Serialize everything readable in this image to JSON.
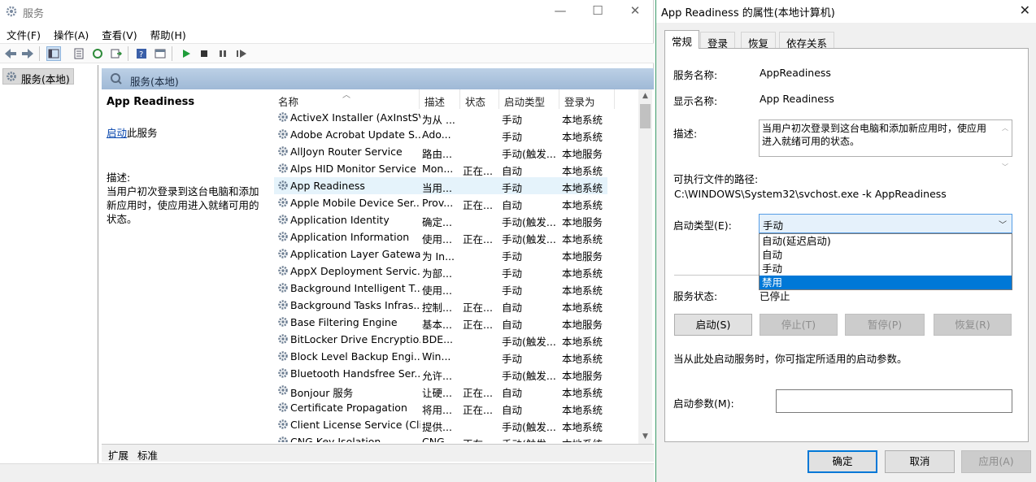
{
  "services_window": {
    "title": "服务",
    "controls": {
      "minimize": "—",
      "maximize": "☐",
      "close": "✕"
    },
    "menu": [
      "文件(F)",
      "操作(A)",
      "查看(V)",
      "帮助(H)"
    ],
    "tree_root": "服务(本地)",
    "pane_header": "服务(本地)",
    "detail": {
      "service_name": "App Readiness",
      "start_link": "启动",
      "start_suffix": "此服务",
      "desc_label": "描述:",
      "desc_text": "当用户初次登录到这台电脑和添加新应用时，使应用进入就绪可用的状态。"
    },
    "columns": {
      "name": "名称",
      "desc": "描述",
      "state": "状态",
      "startup": "启动类型",
      "logon": "登录为"
    },
    "rows": [
      {
        "name": "ActiveX Installer (AxInstSV)",
        "desc": "为从 ...",
        "state": "",
        "startup": "手动",
        "logon": "本地系统"
      },
      {
        "name": "Adobe Acrobat Update S...",
        "desc": "Ado...",
        "state": "",
        "startup": "手动",
        "logon": "本地系统"
      },
      {
        "name": "AllJoyn Router Service",
        "desc": "路由...",
        "state": "",
        "startup": "手动(触发...",
        "logon": "本地服务"
      },
      {
        "name": "Alps HID Monitor Service",
        "desc": "Mon...",
        "state": "正在...",
        "startup": "自动",
        "logon": "本地系统"
      },
      {
        "name": "App Readiness",
        "desc": "当用...",
        "state": "",
        "startup": "手动",
        "logon": "本地系统"
      },
      {
        "name": "Apple Mobile Device Ser...",
        "desc": "Prov...",
        "state": "正在...",
        "startup": "自动",
        "logon": "本地系统"
      },
      {
        "name": "Application Identity",
        "desc": "确定...",
        "state": "",
        "startup": "手动(触发...",
        "logon": "本地服务"
      },
      {
        "name": "Application Information",
        "desc": "使用...",
        "state": "正在...",
        "startup": "手动(触发...",
        "logon": "本地系统"
      },
      {
        "name": "Application Layer Gatewa...",
        "desc": "为 In...",
        "state": "",
        "startup": "手动",
        "logon": "本地服务"
      },
      {
        "name": "AppX Deployment Servic...",
        "desc": "为部...",
        "state": "",
        "startup": "手动",
        "logon": "本地系统"
      },
      {
        "name": "Background Intelligent T...",
        "desc": "使用...",
        "state": "",
        "startup": "手动",
        "logon": "本地系统"
      },
      {
        "name": "Background Tasks Infras...",
        "desc": "控制...",
        "state": "正在...",
        "startup": "自动",
        "logon": "本地系统"
      },
      {
        "name": "Base Filtering Engine",
        "desc": "基本...",
        "state": "正在...",
        "startup": "自动",
        "logon": "本地服务"
      },
      {
        "name": "BitLocker Drive Encryptio...",
        "desc": "BDE...",
        "state": "",
        "startup": "手动(触发...",
        "logon": "本地系统"
      },
      {
        "name": "Block Level Backup Engi...",
        "desc": "Win...",
        "state": "",
        "startup": "手动",
        "logon": "本地系统"
      },
      {
        "name": "Bluetooth Handsfree Ser...",
        "desc": "允许...",
        "state": "",
        "startup": "手动(触发...",
        "logon": "本地服务"
      },
      {
        "name": "Bonjour 服务",
        "desc": "让硬...",
        "state": "正在...",
        "startup": "自动",
        "logon": "本地系统"
      },
      {
        "name": "Certificate Propagation",
        "desc": "将用...",
        "state": "正在...",
        "startup": "自动",
        "logon": "本地系统"
      },
      {
        "name": "Client License Service (Cli...",
        "desc": "提供...",
        "state": "",
        "startup": "手动(触发...",
        "logon": "本地系统"
      },
      {
        "name": "CNG Key Isolation",
        "desc": "CNG...",
        "state": "正在...",
        "startup": "手动(触发...",
        "logon": "本地系统"
      }
    ],
    "bottom_tabs": [
      "扩展",
      "标准"
    ]
  },
  "dialog": {
    "title": "App Readiness 的属性(本地计算机)",
    "close": "✕",
    "tabs": [
      "常规",
      "登录",
      "恢复",
      "依存关系"
    ],
    "service_name_label": "服务名称:",
    "service_name": "AppReadiness",
    "display_name_label": "显示名称:",
    "display_name": "App Readiness",
    "desc_label": "描述:",
    "desc_text": "当用户初次登录到这台电脑和添加新应用时，使应用进入就绪可用的状态。",
    "path_label": "可执行文件的路径:",
    "path": "C:\\WINDOWS\\System32\\svchost.exe -k AppReadiness",
    "startup_label": "启动类型(E):",
    "startup_selected": "手动",
    "startup_options": [
      "自动(延迟启动)",
      "自动",
      "手动",
      "禁用"
    ],
    "status_label": "服务状态:",
    "status_value": "已停止",
    "buttons": {
      "start": "启动(S)",
      "stop": "停止(T)",
      "pause": "暂停(P)",
      "resume": "恢复(R)"
    },
    "hint": "当从此处启动服务时，你可指定所适用的启动参数。",
    "param_label": "启动参数(M):",
    "footer": {
      "ok": "确定",
      "cancel": "取消",
      "apply": "应用(A)"
    }
  },
  "colors": {
    "accent": "#0078d7",
    "pane_header": "#a9c1dc",
    "selection": "#e5f3fb"
  }
}
